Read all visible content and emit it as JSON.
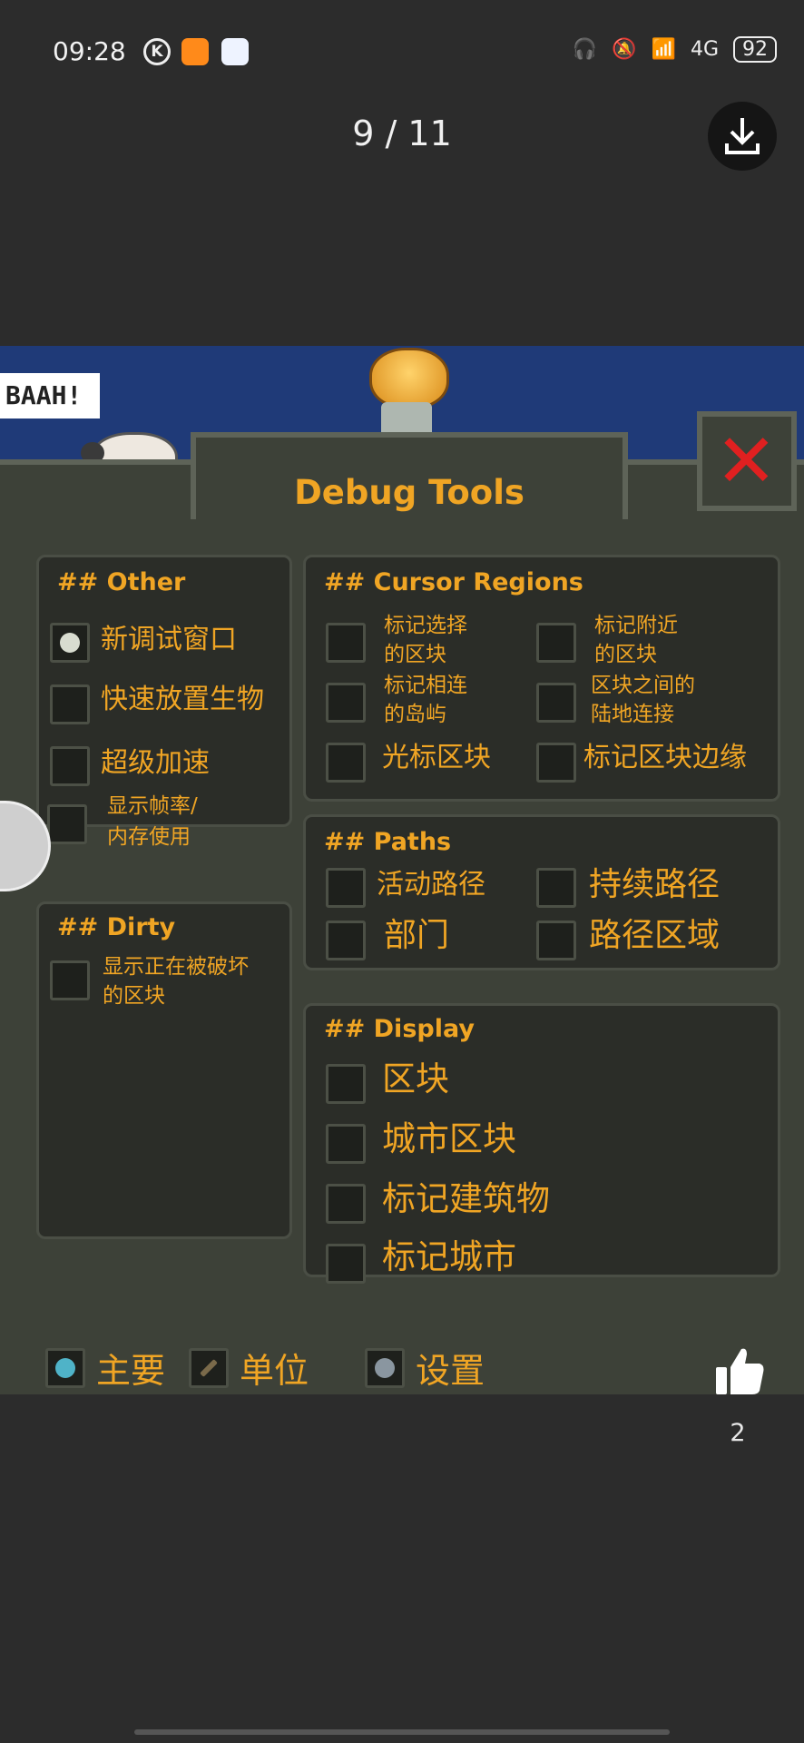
{
  "status_bar": {
    "time": "09:28",
    "battery": "92",
    "network": "4G"
  },
  "viewer": {
    "page_indicator": "9 / 11",
    "like_count": "2"
  },
  "game": {
    "speech_bubble": "BAAH!",
    "window_title": "Debug Tools",
    "close_symbol": "✕",
    "panels": {
      "other": {
        "header": "## Other",
        "items": [
          "新调试窗口",
          "快速放置生物",
          "超级加速",
          "显示帧率/内存使用"
        ],
        "item4_lines": [
          "显示帧率/",
          "内存使用"
        ]
      },
      "dirty": {
        "header": "## Dirty",
        "lines": [
          "显示正在被破坏",
          "的区块"
        ]
      },
      "cursor_regions": {
        "header": "## Cursor Regions",
        "a1": [
          "标记选择",
          "的区块"
        ],
        "a2": [
          "标记附近",
          "的区块"
        ],
        "b1": [
          "标记相连",
          "的岛屿"
        ],
        "b2": [
          "区块之间的",
          "陆地连接"
        ],
        "c1": "光标区块",
        "c2": "标记区块边缘"
      },
      "paths": {
        "header": "## Paths",
        "items": [
          "活动路径",
          "持续路径",
          "部门",
          "路径区域"
        ]
      },
      "display": {
        "header": "## Display",
        "items": [
          "区块",
          "城市区块",
          "标记建筑物",
          "标记城市"
        ]
      }
    },
    "bottom_tabs": [
      "主要",
      "单位",
      "设置"
    ]
  }
}
